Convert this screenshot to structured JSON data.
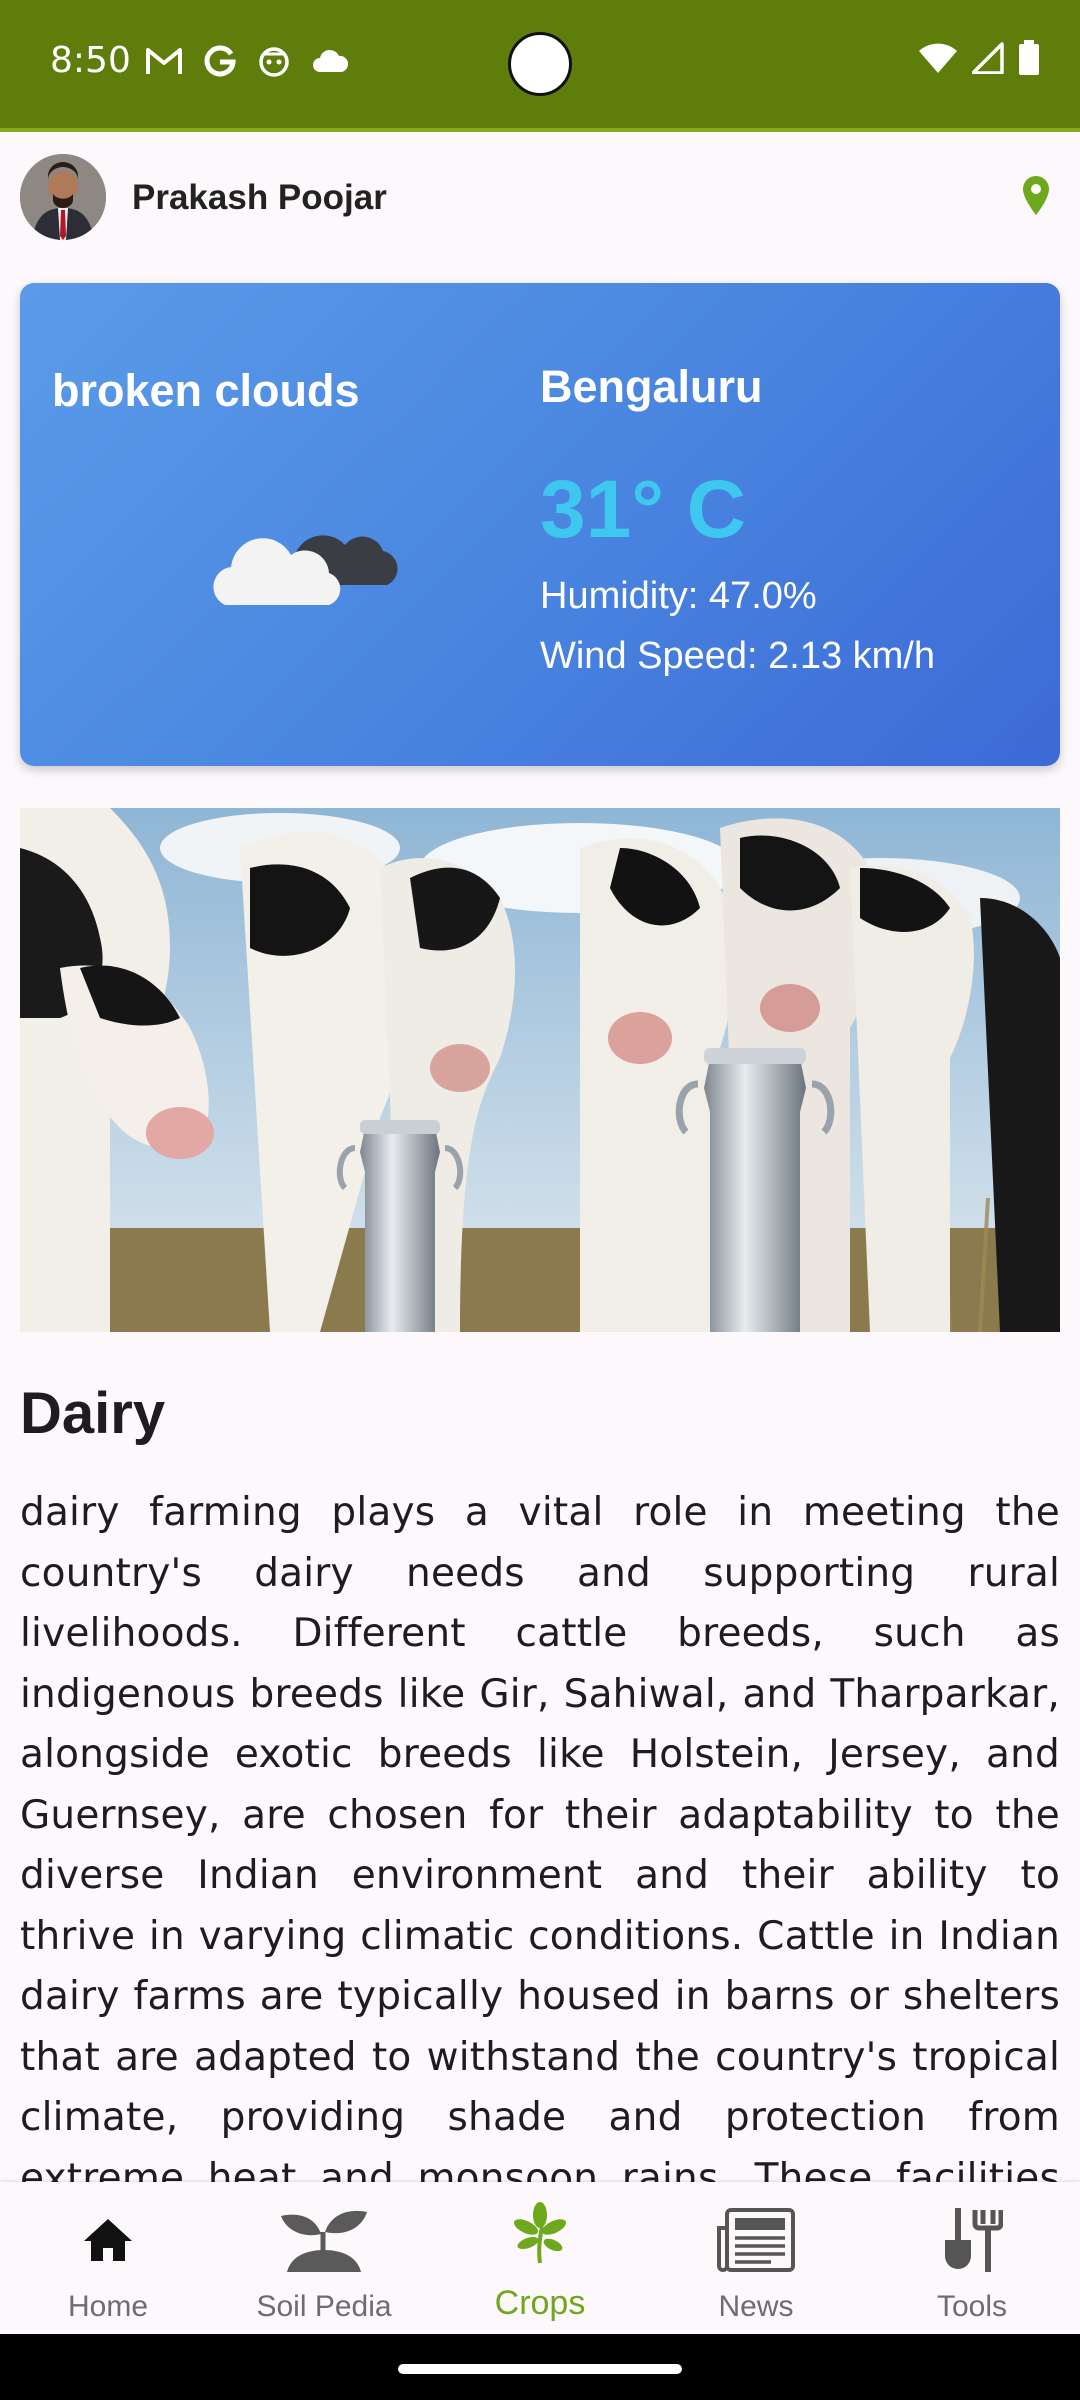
{
  "status_bar": {
    "time": "8:50"
  },
  "header": {
    "username": "Prakash Poojar"
  },
  "weather": {
    "description": "broken clouds",
    "city": "Bengaluru",
    "temperature": "31° C",
    "humidity": "Humidity: 47.0%",
    "wind": "Wind Speed: 2.13 km/h"
  },
  "article": {
    "title": "Dairy",
    "body": "dairy farming plays a vital role in meeting the country's dairy needs and supporting rural livelihoods. Different cattle breeds, such as indigenous breeds like Gir, Sahiwal, and Tharparkar, alongside exotic breeds like Holstein, Jersey, and Guernsey, are chosen for their adaptability to the diverse Indian environment and their ability to thrive in varying climatic conditions. Cattle in Indian dairy farms are typically housed in barns or shelters that are adapted to withstand the country's tropical climate, providing shade and protection from extreme heat and monsoon rains. These facilities ensure the comfort of"
  },
  "nav": {
    "items": [
      {
        "label": "Home",
        "icon": "home-icon"
      },
      {
        "label": "Soil Pedia",
        "icon": "sprout-icon"
      },
      {
        "label": "Crops",
        "icon": "crops-icon",
        "active": true
      },
      {
        "label": "News",
        "icon": "newspaper-icon"
      },
      {
        "label": "Tools",
        "icon": "tools-icon"
      }
    ]
  },
  "colors": {
    "status_bar": "#5e7d0b",
    "accent": "#6ea81c",
    "weather_temp": "#3fc8ef"
  }
}
